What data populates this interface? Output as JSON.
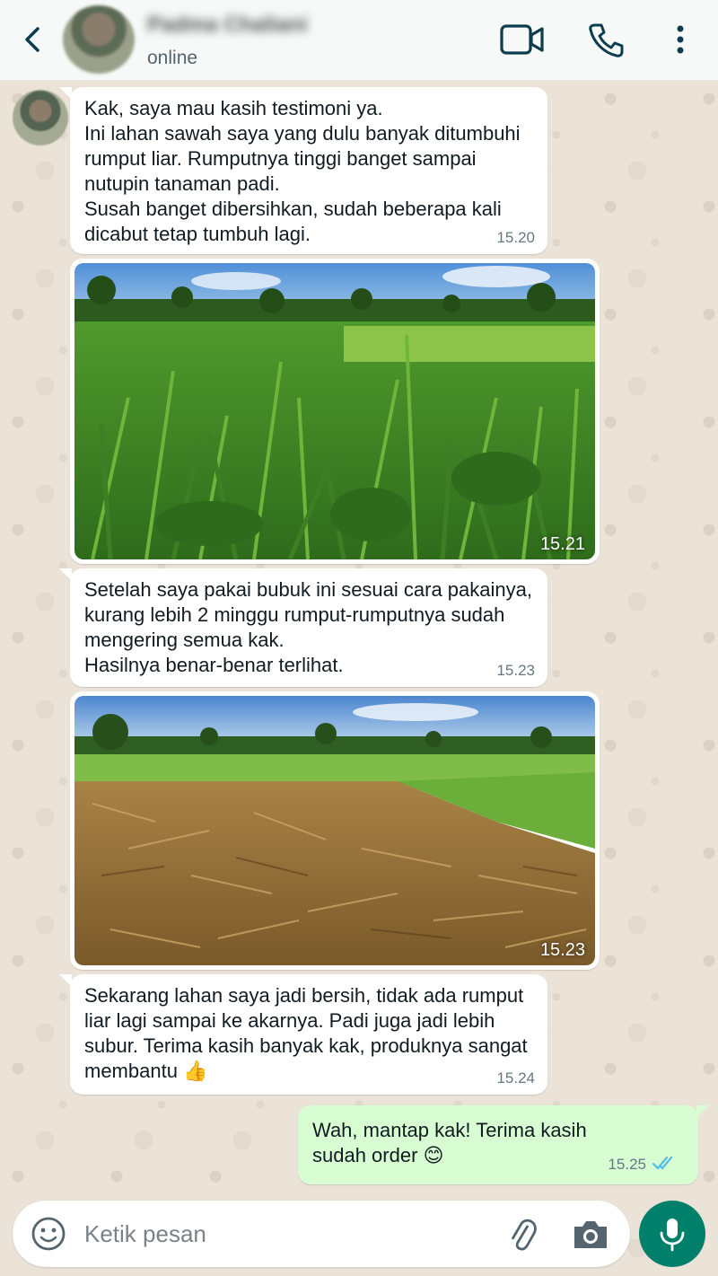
{
  "header": {
    "contact_name": "Padma Chaliani",
    "status": "online"
  },
  "messages": [
    {
      "type": "text",
      "direction": "incoming",
      "text": "Kak, saya mau kasih testimoni ya.\nIni lahan sawah saya yang dulu banyak ditumbuhi rumput liar. Rumputnya tinggi banget sampai nutupin tanaman padi.\nSusah banget dibersihkan, sudah beberapa kali dicabut tetap tumbuh lagi.",
      "time": "15.20"
    },
    {
      "type": "image",
      "direction": "incoming",
      "description": "weedy-rice-field",
      "time": "15.21"
    },
    {
      "type": "text",
      "direction": "incoming",
      "text": "Setelah saya pakai bubuk ini sesuai cara pakainya, kurang lebih 2 minggu rumput-rumputnya sudah mengering semua kak.\nHasilnya benar-benar terlihat.",
      "time": "15.23"
    },
    {
      "type": "image",
      "direction": "incoming",
      "description": "dried-weeds-field",
      "time": "15.23"
    },
    {
      "type": "text",
      "direction": "incoming",
      "text": "Sekarang lahan saya jadi bersih, tidak ada rumput liar lagi sampai ke akarnya. Padi juga jadi lebih subur. Terima kasih banyak kak, produknya sangat membantu 👍",
      "time": "15.24"
    },
    {
      "type": "text",
      "direction": "outgoing",
      "text": "Wah, mantap kak! Terima kasih sudah order 😊",
      "time": "15.25",
      "read_status": "read"
    }
  ],
  "input": {
    "placeholder": "Ketik pesan"
  },
  "icons": {
    "back": "chevron-left-icon",
    "video": "video-camera-icon",
    "call": "phone-icon",
    "menu": "more-vertical-icon",
    "emoji": "smiley-icon",
    "attach": "paperclip-icon",
    "camera": "camera-icon",
    "mic": "microphone-icon"
  },
  "colors": {
    "accent": "#00806a",
    "outgoing_bubble": "#d9fdd3",
    "incoming_bubble": "#ffffff",
    "read_ticks": "#53bdeb",
    "header_icons": "#0b3d4f"
  }
}
